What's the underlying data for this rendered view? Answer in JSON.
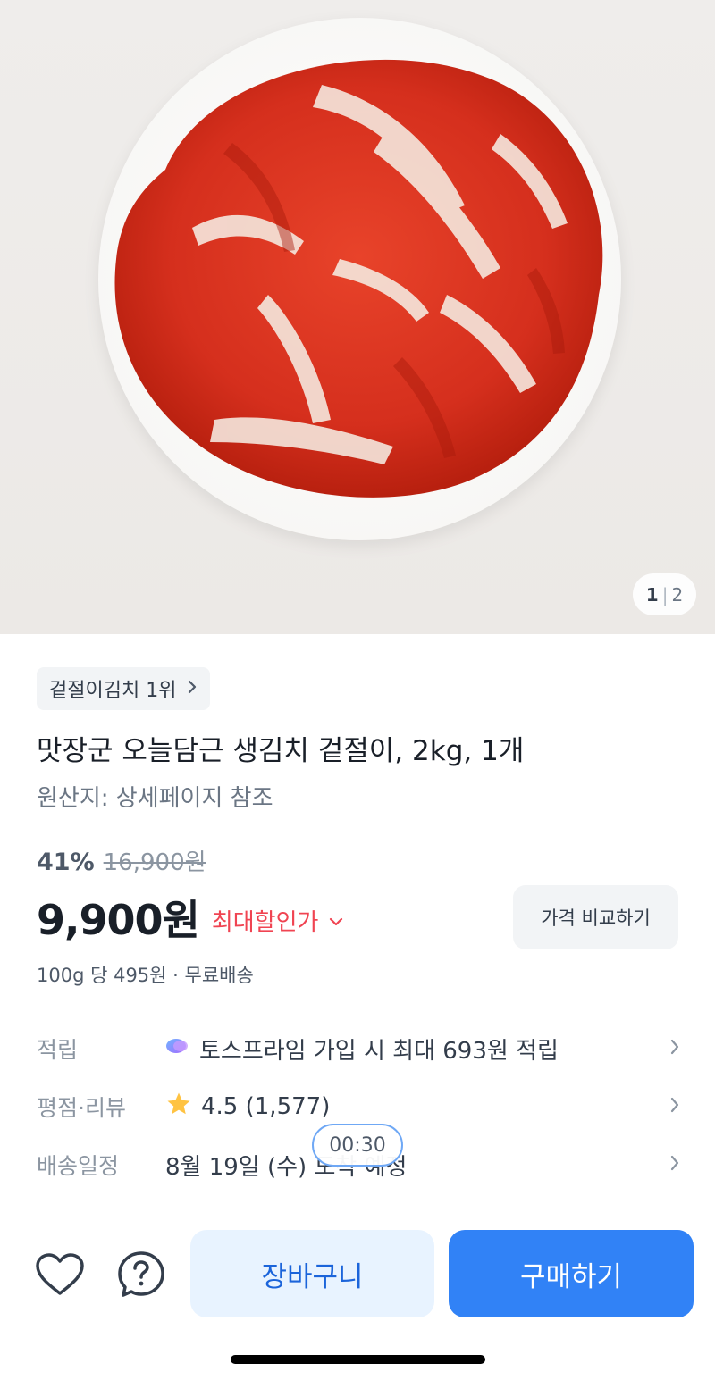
{
  "gallery": {
    "current": "1",
    "total": "2",
    "image_icon": "kimchi-plate-photo"
  },
  "rank_badge": {
    "label": "겉절이김치 1위",
    "icon": "chevron-right-icon"
  },
  "product": {
    "title": "맛장군 오늘담근 생김치 겉절이, 2kg, 1개",
    "origin": "원산지: 상세페이지 참조"
  },
  "pricing": {
    "discount": "41%",
    "original_price": "16,900원",
    "price": "9,900원",
    "max_discount_label": "최대할인가",
    "compare_button": "가격 비교하기",
    "unit_price": "100g 당 495원 · 무료배송"
  },
  "info_rows": [
    {
      "label": "적립",
      "value": "토스프라임 가입 시 최대 693원 적립",
      "icon": "toss-prime-icon"
    },
    {
      "label": "평점·리뷰",
      "value": "4.5 (1,577)",
      "icon": "star-icon"
    },
    {
      "label": "배송일정",
      "value": "8월 19일 (수) 도착 예정"
    }
  ],
  "timer": "00:30",
  "bottom_bar": {
    "wishlist_icon": "heart-icon",
    "help_icon": "question-icon",
    "cart_label": "장바구니",
    "buy_label": "구매하기"
  },
  "colors": {
    "primary": "#3182f6",
    "cart_bg": "#e8f3ff",
    "accent_red": "#f04452"
  }
}
